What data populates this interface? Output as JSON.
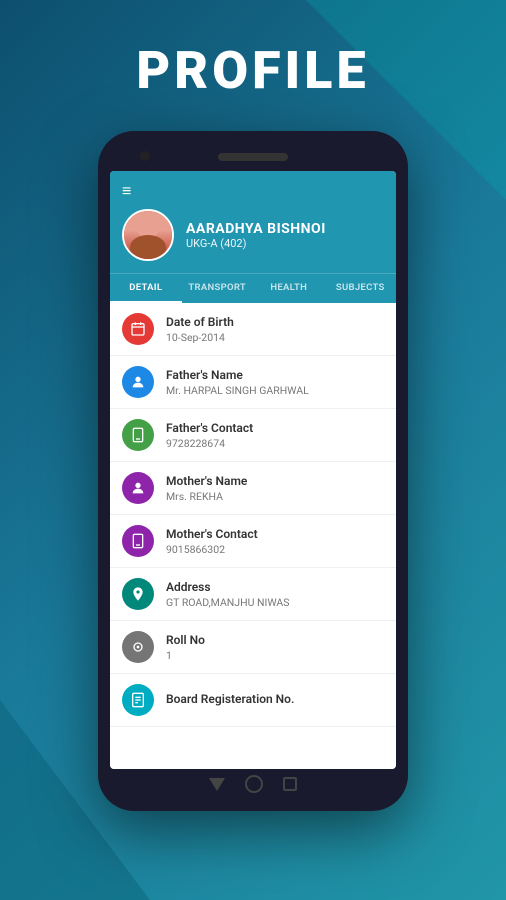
{
  "page": {
    "title": "PROFILE",
    "background_top": "#0d4f6e",
    "background_bottom": "#1a7a9a"
  },
  "header": {
    "hamburger_icon": "≡",
    "profile_name": "AARADHYA BISHNOI",
    "profile_class": "UKG-A (402)"
  },
  "tabs": [
    {
      "label": "DETAIL",
      "active": true
    },
    {
      "label": "TRANSPORT",
      "active": false
    },
    {
      "label": "HEALTH",
      "active": false
    },
    {
      "label": "SUBJECTS",
      "active": false
    }
  ],
  "detail_items": [
    {
      "id": "dob",
      "icon_color": "icon-red",
      "icon_symbol": "📅",
      "label": "Date of Birth",
      "value": "10-Sep-2014"
    },
    {
      "id": "father-name",
      "icon_color": "icon-blue",
      "icon_symbol": "👤",
      "label": "Father's Name",
      "value": "Mr. HARPAL SINGH GARHWAL"
    },
    {
      "id": "father-contact",
      "icon_color": "icon-green",
      "icon_symbol": "📱",
      "label": "Father's Contact",
      "value": "9728228674"
    },
    {
      "id": "mother-name",
      "icon_color": "icon-purple",
      "icon_symbol": "👤",
      "label": "Mother's Name",
      "value": "Mrs. REKHA"
    },
    {
      "id": "mother-contact",
      "icon_color": "icon-purple",
      "icon_symbol": "📱",
      "label": "Mother's Contact",
      "value": "9015866302"
    },
    {
      "id": "address",
      "icon_color": "icon-teal",
      "icon_symbol": "🏠",
      "label": "Address",
      "value": "GT ROAD,MANJHU NIWAS"
    },
    {
      "id": "roll-no",
      "icon_color": "icon-gray",
      "icon_symbol": "●",
      "label": "Roll No",
      "value": "1"
    },
    {
      "id": "board-reg",
      "icon_color": "icon-cyan",
      "icon_symbol": "📋",
      "label": "Board Registeration No.",
      "value": ""
    }
  ]
}
